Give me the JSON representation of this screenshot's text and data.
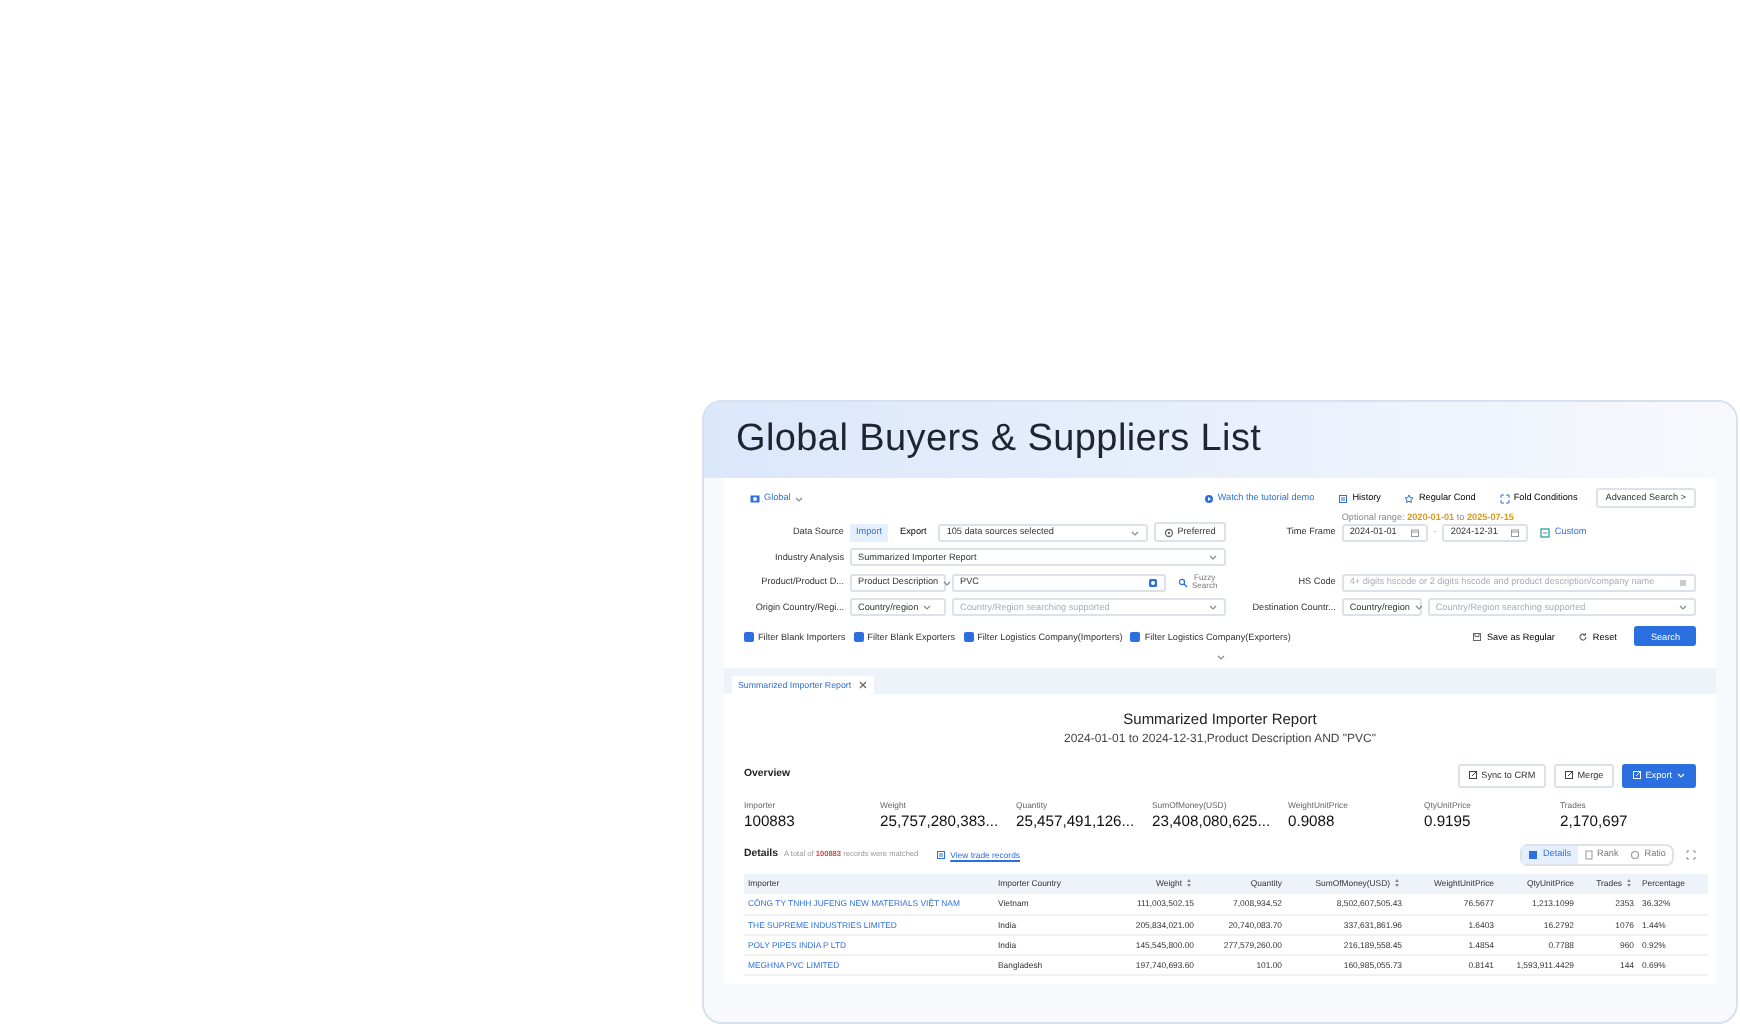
{
  "header": {
    "title": "Global Buyers & Suppliers List"
  },
  "scope": {
    "label": "Global"
  },
  "toolbar_links": [
    {
      "label": "Watch the tutorial demo",
      "kind": "play"
    },
    {
      "label": "History",
      "kind": "history"
    },
    {
      "label": "Regular Cond",
      "kind": "star"
    },
    {
      "label": "Fold Conditions",
      "kind": "fold"
    }
  ],
  "advanced_search": "Advanced Search >",
  "optional_range": {
    "prefix": "Optional range:",
    "start": "2020-01-01",
    "joiner": "to",
    "end": "2025-07-15"
  },
  "data_source": {
    "label": "Data Source",
    "toggles": [
      {
        "label": "Import",
        "selected": true
      },
      {
        "label": "Export",
        "selected": false
      }
    ],
    "value": "105 data sources selected",
    "preferred": "Preferred"
  },
  "industry": {
    "label": "Industry Analysis",
    "value": "Summarized Importer Report"
  },
  "product": {
    "label": "Product/Product D...",
    "type": "Product Description",
    "value": "PVC",
    "fuzzy": "Fuzzy Search"
  },
  "origin": {
    "label": "Origin Country/Regi...",
    "type": "Country/region",
    "placeholder": "Country/Region searching supported"
  },
  "time_frame": {
    "label": "Time Frame",
    "start": "2024-01-01",
    "separator": "-",
    "end": "2024-12-31",
    "custom": "Custom"
  },
  "hs_code": {
    "label": "HS Code",
    "placeholder": "4+ digits hscode or 2 digits hscode and product description/company name"
  },
  "destination": {
    "label": "Destination Countr...",
    "type": "Country/region",
    "placeholder": "Country/Region searching supported"
  },
  "filters": [
    {
      "label": "Filter Blank Importers",
      "checked": true
    },
    {
      "label": "Filter Blank Exporters",
      "checked": true
    },
    {
      "label": "Filter Logistics Company(Importers)",
      "checked": true
    },
    {
      "label": "Filter Logistics Company(Exporters)",
      "checked": true
    }
  ],
  "actions": {
    "save": "Save as Regular",
    "reset": "Reset",
    "search": "Search"
  },
  "tabs": [
    {
      "label": "Summarized Importer Report",
      "selected": true
    }
  ],
  "report": {
    "title": "Summarized Importer Report",
    "subtitle": "2024-01-01 to 2024-12-31,Product Description AND \"PVC\""
  },
  "overview": {
    "title": "Overview",
    "buttons": [
      {
        "label": "Sync to CRM",
        "kind": "plain"
      },
      {
        "label": "Merge",
        "kind": "plain"
      },
      {
        "label": "Export",
        "kind": "primary"
      }
    ],
    "stats": [
      {
        "label": "Importer",
        "value": "100883"
      },
      {
        "label": "Weight",
        "value": "25,757,280,383..."
      },
      {
        "label": "Quantity",
        "value": "25,457,491,126..."
      },
      {
        "label": "SumOfMoney(USD)",
        "value": "23,408,080,625..."
      },
      {
        "label": "WeightUnitPrice",
        "value": "0.9088"
      },
      {
        "label": "QtyUnitPrice",
        "value": "0.9195"
      },
      {
        "label": "Trades",
        "value": "2,170,697"
      }
    ]
  },
  "details": {
    "title": "Details",
    "prefix": "A total of",
    "count": "100883",
    "suffix": "records were matched",
    "link": "View trade records",
    "views": [
      {
        "label": "Details",
        "selected": true
      },
      {
        "label": "Rank",
        "selected": false
      },
      {
        "label": "Ratio",
        "selected": false
      }
    ]
  },
  "table": {
    "columns": [
      {
        "label": "Importer",
        "sortable": false
      },
      {
        "label": "Importer Country",
        "sortable": false
      },
      {
        "label": "Weight",
        "sortable": true
      },
      {
        "label": "Quantity",
        "sortable": false
      },
      {
        "label": "SumOfMoney(USD)",
        "sortable": true
      },
      {
        "label": "WeightUnitPrice",
        "sortable": false
      },
      {
        "label": "QtyUnitPrice",
        "sortable": false
      },
      {
        "label": "Trades",
        "sortable": true
      },
      {
        "label": "Percentage",
        "sortable": false
      }
    ],
    "rows": [
      [
        "CÔNG TY TNHH JUFENG NEW MATERIALS VIỆT NAM",
        "Vietnam",
        "111,003,502.15",
        "7,008,934.52",
        "8,502,607,505.43",
        "76.5677",
        "1,213.1099",
        "2353",
        "36.32%"
      ],
      [
        "THE SUPREME INDUSTRIES LIMITED",
        "India",
        "205,834,021.00",
        "20,740,083.70",
        "337,631,861.96",
        "1.6403",
        "16.2792",
        "1076",
        "1.44%"
      ],
      [
        "POLY PIPES INDIA P LTD",
        "India",
        "145,545,800.00",
        "277,579,260.00",
        "216,189,558.45",
        "1.4854",
        "0.7788",
        "960",
        "0.92%"
      ],
      [
        "MEGHNA PVC LIMITED",
        "Bangladesh",
        "197,740,693.60",
        "101.00",
        "160,985,055.73",
        "0.8141",
        "1,593,911.4429",
        "144",
        "0.69%"
      ]
    ]
  }
}
